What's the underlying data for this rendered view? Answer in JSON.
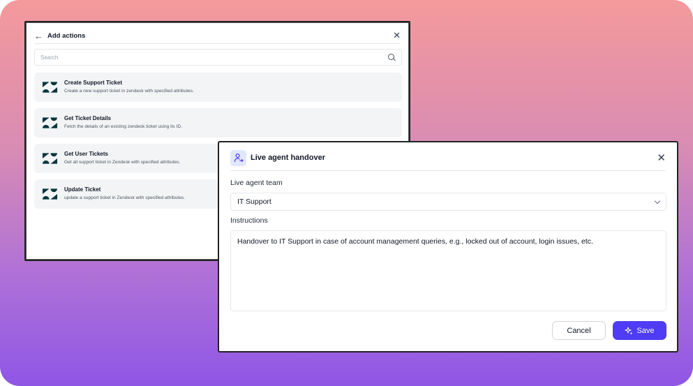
{
  "add_actions": {
    "title": "Add actions",
    "search_placeholder": "Search",
    "actions": [
      {
        "title": "Create Support Ticket",
        "description": "Create a new support ticket in zendesk with specified attributes.",
        "icon": "zendesk-icon"
      },
      {
        "title": "Get Ticket Details",
        "description": "Fetch the details of an existing zendesk ticket using its ID.",
        "icon": "zendesk-icon"
      },
      {
        "title": "Get User Tickets",
        "description": "Get all support ticket in Zendesk with specified attributes.",
        "icon": "zendesk-icon"
      },
      {
        "title": "Update Ticket",
        "description": "update a support ticket in Zendesk with specified attributes.",
        "icon": "zendesk-icon"
      }
    ]
  },
  "handover": {
    "title": "Live agent handover",
    "icon": "user-transfer-icon",
    "team_label": "Live agent team",
    "team_value": "IT Support",
    "instructions_label": "Instructions",
    "instructions_value": "Handover to IT Support in case of account management queries, e.g., locked out of account, login issues, etc.",
    "cancel_label": "Cancel",
    "save_label": "Save"
  },
  "colors": {
    "accent": "#4f3cf4",
    "zendesk": "#03363d",
    "icon_bg": "#e0e7ff"
  }
}
